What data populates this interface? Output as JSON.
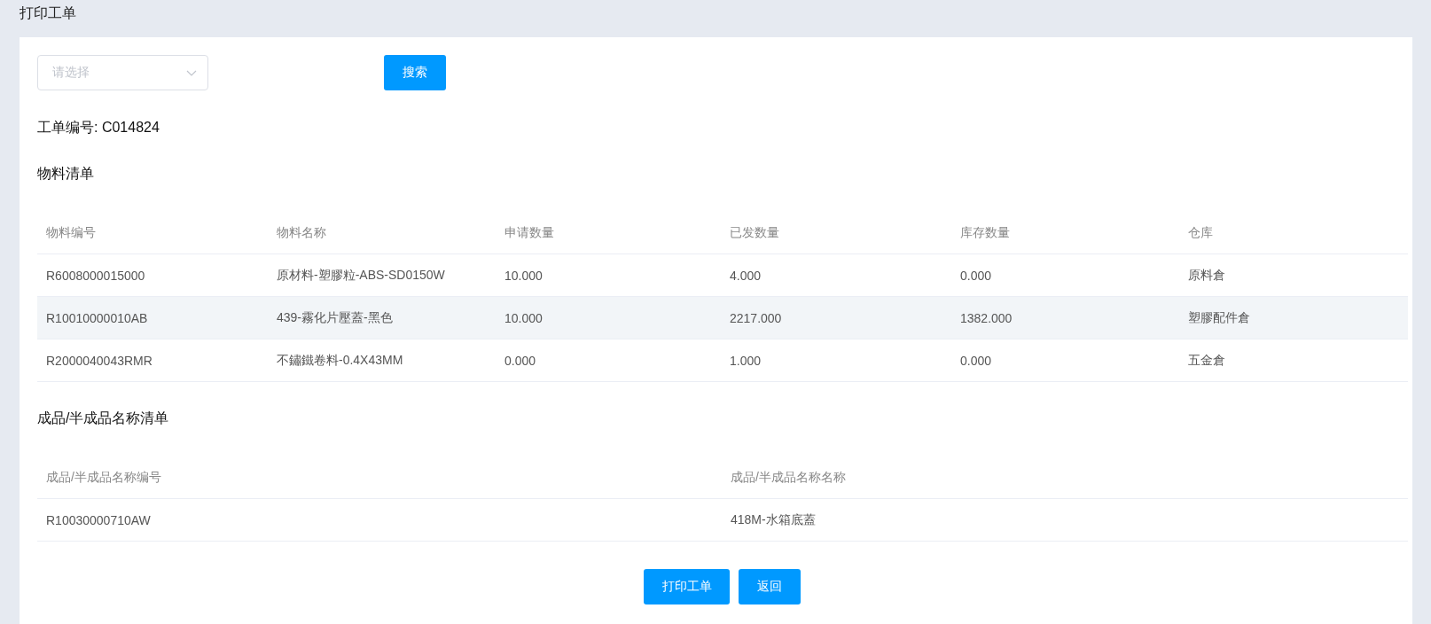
{
  "page_title": "打印工单",
  "filter": {
    "select_placeholder": "请选择",
    "search_button": "搜索"
  },
  "order_number": {
    "label": "工单编号:",
    "value": "C014824"
  },
  "materials": {
    "title": "物料清单",
    "columns": [
      "物料编号",
      "物料名称",
      "申请数量",
      "已发数量",
      "库存数量",
      "仓库"
    ],
    "rows": [
      {
        "highlighted": false,
        "cells": [
          "R6008000015000",
          "原材料-塑膠粒-ABS-SD0150W",
          "10.000",
          "4.000",
          "0.000",
          "原料倉"
        ]
      },
      {
        "highlighted": true,
        "cells": [
          "R10010000010AB",
          "439-霧化片壓蓋-黑色",
          "10.000",
          "2217.000",
          "1382.000",
          "塑膠配件倉"
        ]
      },
      {
        "highlighted": false,
        "cells": [
          "R2000040043RMR",
          "不鏽鐵卷料-0.4X43MM",
          "0.000",
          "1.000",
          "0.000",
          "五金倉"
        ]
      }
    ]
  },
  "products": {
    "title": "成品/半成品名称清单",
    "columns": [
      "成品/半成品名称编号",
      "成品/半成品名称名称"
    ],
    "rows": [
      {
        "highlighted": false,
        "cells": [
          "R10030000710AW",
          "418M-水箱底蓋"
        ]
      }
    ]
  },
  "actions": [
    "打印工单",
    "返回"
  ]
}
